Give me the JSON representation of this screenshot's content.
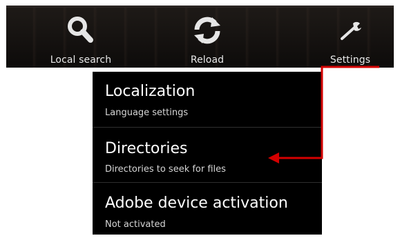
{
  "action_bar": {
    "items": [
      {
        "label": "Local search",
        "icon": "search-icon"
      },
      {
        "label": "Reload",
        "icon": "reload-icon"
      },
      {
        "label": "Settings",
        "icon": "wrench-icon"
      }
    ]
  },
  "settings_menu": {
    "items": [
      {
        "title": "Localization",
        "subtitle": "Language settings"
      },
      {
        "title": "Directories",
        "subtitle": "Directories to seek for files"
      },
      {
        "title": "Adobe device activation",
        "subtitle": "Not activated"
      }
    ]
  },
  "colors": {
    "callout": "#d40000",
    "menu_background": "#000000",
    "action_bar_background": "#141110"
  }
}
